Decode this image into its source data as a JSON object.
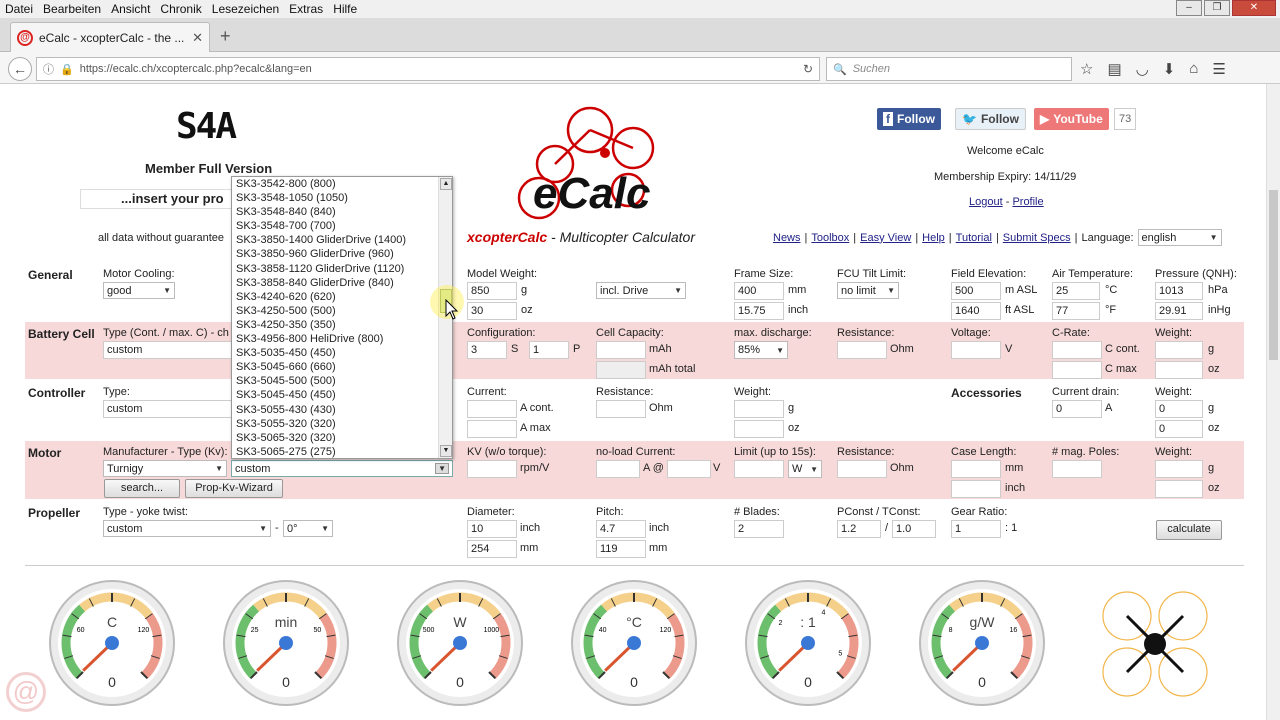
{
  "menubar": {
    "items": [
      "Datei",
      "Bearbeiten",
      "Ansicht",
      "Chronik",
      "Lesezeichen",
      "Extras",
      "Hilfe"
    ]
  },
  "tab": {
    "title": "eCalc - xcopterCalc - the ..."
  },
  "nav": {
    "url": "https://ecalc.ch/xcoptercalc.php?ecalc&lang=en",
    "search_placeholder": "Suchen"
  },
  "header": {
    "lcd": "S4A",
    "member": "Member Full Version",
    "insert": "...insert your pro",
    "disclaimer": "all data without guarantee",
    "brand": "eCalc",
    "subtitle_bold": "xcopterCalc",
    "subtitle_rest": " - Multicopter Calculator"
  },
  "social": {
    "facebook": "Follow",
    "twitter": "Follow",
    "youtube": "YouTube",
    "youtube_count": "73"
  },
  "account": {
    "welcome": "Welcome eCalc",
    "expiry": "Membership Expiry: 14/11/29",
    "logout": "Logout",
    "profile": "Profile"
  },
  "topnav": {
    "links": [
      "News",
      "Toolbox",
      "Easy View",
      "Help",
      "Tutorial",
      "Submit Specs"
    ],
    "language_label": "Language:",
    "language": "english"
  },
  "general": {
    "title": "General",
    "motor_cooling_label": "Motor Cooling:",
    "motor_cooling": "good",
    "model_weight_label": "Model Weight:",
    "model_weight_g": "850",
    "g": "g",
    "model_weight_oz": "30",
    "oz": "oz",
    "incl": "incl. Drive",
    "frame_size_label": "Frame Size:",
    "frame_mm": "400",
    "mm": "mm",
    "frame_inch": "15.75",
    "inch": "inch",
    "fcu_label": "FCU Tilt Limit:",
    "fcu": "no limit",
    "elev_label": "Field Elevation:",
    "elev_m": "500",
    "m_asl": "m ASL",
    "elev_ft": "1640",
    "ft_asl": "ft ASL",
    "air_label": "Air Temperature:",
    "air_c": "25",
    "c": "°C",
    "air_f": "77",
    "f": "°F",
    "pres_label": "Pressure (QNH):",
    "pres_hpa": "1013",
    "hpa": "hPa",
    "pres_inhg": "29.91",
    "inhg": "inHg"
  },
  "battery": {
    "title": "Battery Cell",
    "type_label": "Type (Cont. / max. C) - ch",
    "type": "custom",
    "config_label": "Configuration:",
    "s_val": "3",
    "s": "S",
    "p_val": "1",
    "p": "P",
    "capacity_label": "Cell Capacity:",
    "mah": "mAh",
    "mah_total": "mAh total",
    "maxdis_label": "max. discharge:",
    "maxdis": "85%",
    "res_label": "Resistance:",
    "ohm": "Ohm",
    "volt_label": "Voltage:",
    "v": "V",
    "crate_label": "C-Rate:",
    "ccont": "C cont.",
    "cmax": "C max",
    "weight_label": "Weight:",
    "g": "g",
    "oz": "oz"
  },
  "controller": {
    "title": "Controller",
    "type_label": "Type:",
    "type": "custom",
    "current_label": "Current:",
    "acont": "A cont.",
    "amax": "A max",
    "res_label": "Resistance:",
    "ohm": "Ohm",
    "weight_label": "Weight:",
    "g": "g",
    "oz": "oz",
    "acc_title": "Accessories",
    "drain_label": "Current drain:",
    "drain": "0",
    "a": "A",
    "acc_weight_label": "Weight:",
    "acc_g": "0",
    "acc_oz": "0"
  },
  "motor": {
    "title": "Motor",
    "manu_label": "Manufacturer - Type (Kv):",
    "manufacturer": "Turnigy",
    "type": "custom",
    "search": "search...",
    "wizard": "Prop-Kv-Wizard",
    "kv_label": "KV (w/o torque):",
    "rpmv": "rpm/V",
    "noload_label": "no-load Current:",
    "a_at": "A @",
    "v": "V",
    "limit_label": "Limit (up to 15s):",
    "w": "W",
    "res_label": "Resistance:",
    "ohm": "Ohm",
    "case_label": "Case Length:",
    "mm": "mm",
    "inch": "inch",
    "poles_label": "# mag. Poles:",
    "weight_label": "Weight:",
    "g": "g",
    "oz": "oz"
  },
  "propeller": {
    "title": "Propeller",
    "type_label": "Type - yoke twist:",
    "type": "custom",
    "dash": "-",
    "twist": "0°",
    "dia_label": "Diameter:",
    "dia_in": "10",
    "inch": "inch",
    "dia_mm": "254",
    "mm": "mm",
    "pitch_label": "Pitch:",
    "pitch_in": "4.7",
    "pitch_mm": "119",
    "blades_label": "# Blades:",
    "blades": "2",
    "pconst_label": "PConst / TConst:",
    "pconst": "1.2",
    "slash": "/",
    "tconst": "1.0",
    "gear_label": "Gear Ratio:",
    "gear": "1",
    "gear_suffix": ": 1",
    "calculate": "calculate"
  },
  "dropdown": {
    "options": [
      "SK3-3542-800 (800)",
      "SK3-3548-1050 (1050)",
      "SK3-3548-840 (840)",
      "SK3-3548-700 (700)",
      "SK3-3850-1400 GliderDrive (1400)",
      "SK3-3850-960 GliderDrive (960)",
      "SK3-3858-1120 GliderDrive (1120)",
      "SK3-3858-840 GliderDrive (840)",
      "SK3-4240-620 (620)",
      "SK3-4250-500 (500)",
      "SK3-4250-350 (350)",
      "SK3-4956-800 HeliDrive (800)",
      "SK3-5035-450 (450)",
      "SK3-5045-660 (660)",
      "SK3-5045-500 (500)",
      "SK3-5045-450 (450)",
      "SK3-5055-430 (430)",
      "SK3-5055-320 (320)",
      "SK3-5065-320 (320)",
      "SK3-5065-275 (275)"
    ]
  },
  "gauges": [
    {
      "unit": "C",
      "value": "0",
      "ticks": [
        "60",
        "120"
      ],
      "name": "load"
    },
    {
      "unit": "min",
      "value": "0",
      "ticks": [
        "25",
        "50"
      ],
      "name": "flight-time"
    },
    {
      "unit": "W",
      "value": "0",
      "ticks": [
        "500",
        "1000"
      ],
      "name": "power"
    },
    {
      "unit": "°C",
      "value": "0",
      "ticks": [
        "40",
        "120"
      ],
      "name": "temperature"
    },
    {
      "unit": ": 1",
      "value": "0",
      "ticks": [
        "2",
        "4",
        "5"
      ],
      "name": "thrust-weight"
    },
    {
      "unit": "g/W",
      "value": "0",
      "ticks": [
        "8",
        "16"
      ],
      "name": "efficiency"
    }
  ],
  "colors": {
    "accent": "#c00000",
    "pink": "#f7d9d9",
    "fb": "#3b5998"
  }
}
